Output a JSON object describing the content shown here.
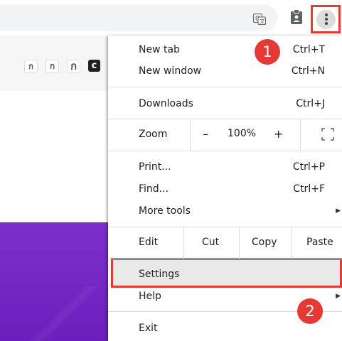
{
  "toolbar": {
    "icons": [
      "translate-icon",
      "clipboard-icon",
      "kebab-menu-icon"
    ]
  },
  "extensions": {
    "icons": [
      {
        "glyph": "ก",
        "name": "ext-thai-small"
      },
      {
        "glyph": "ก",
        "name": "ext-thai-medium"
      },
      {
        "glyph": "ก",
        "name": "ext-thai-large"
      },
      {
        "glyph": "c",
        "name": "ext-c-black"
      }
    ]
  },
  "menu": {
    "new_tab": {
      "label": "New tab",
      "shortcut": "Ctrl+T"
    },
    "new_window": {
      "label": "New window",
      "shortcut": "Ctrl+N"
    },
    "downloads": {
      "label": "Downloads",
      "shortcut": "Ctrl+J"
    },
    "zoom": {
      "label": "Zoom",
      "minus": "–",
      "value": "100%",
      "plus": "+"
    },
    "print": {
      "label": "Print...",
      "shortcut": "Ctrl+P"
    },
    "find": {
      "label": "Find...",
      "shortcut": "Ctrl+F"
    },
    "more_tools": {
      "label": "More tools"
    },
    "edit": {
      "label": "Edit",
      "cut": "Cut",
      "copy": "Copy",
      "paste": "Paste"
    },
    "settings": {
      "label": "Settings"
    },
    "help": {
      "label": "Help"
    },
    "exit": {
      "label": "Exit"
    }
  },
  "annotations": {
    "step1": "1",
    "step2": "2"
  },
  "colors": {
    "highlight": "#e53935",
    "banner": "#7d2fc9"
  }
}
